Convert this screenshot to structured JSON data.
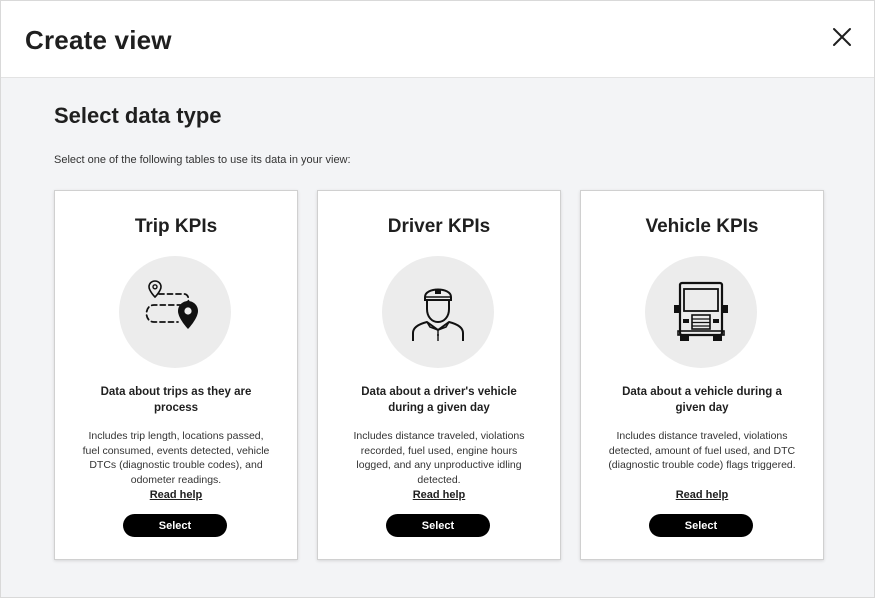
{
  "dialog": {
    "title": "Create view",
    "close_icon": "close-icon"
  },
  "section": {
    "title": "Select data type",
    "instruction": "Select one of the following tables to use its data in your view:"
  },
  "cards": [
    {
      "title": "Trip KPIs",
      "icon": "trip-route-icon",
      "subtitle": "Data about trips as they are process",
      "description": "Includes trip length, locations passed, fuel consumed, events detected, vehicle DTCs (diagnostic trouble codes), and odometer readings.",
      "help_label": "Read help",
      "select_label": "Select"
    },
    {
      "title": "Driver KPIs",
      "icon": "driver-icon",
      "subtitle": "Data about a driver's vehicle during a given day",
      "description": "Includes distance traveled, violations recorded, fuel used, engine hours logged, and any unproductive idling detected.",
      "help_label": "Read help",
      "select_label": "Select"
    },
    {
      "title": "Vehicle KPIs",
      "icon": "truck-icon",
      "subtitle": "Data about a vehicle during a given day",
      "description": "Includes distance traveled, violations detected, amount of fuel used, and DTC (diagnostic trouble code) flags triggered.",
      "help_label": "Read help",
      "select_label": "Select"
    }
  ],
  "colors": {
    "button_bg": "#000000",
    "button_text": "#ffffff",
    "page_bg": "#f3f4f6",
    "icon_circle": "#ececec"
  }
}
